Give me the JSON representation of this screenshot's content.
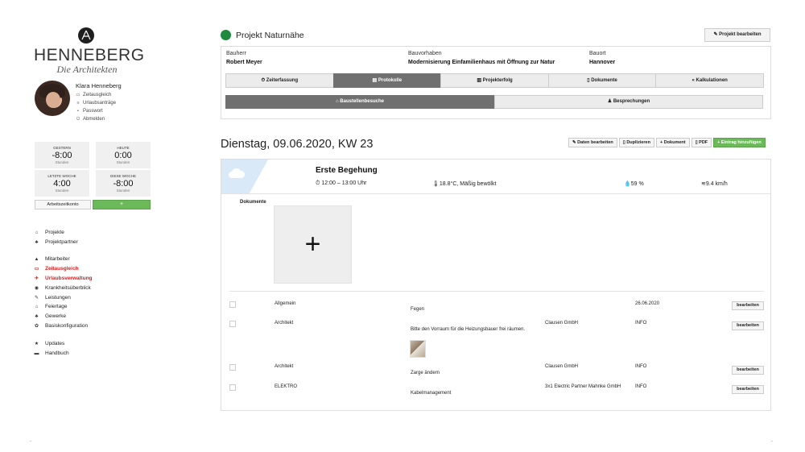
{
  "brand": {
    "name": "HENNEBERG",
    "tagline": "Die Architekten"
  },
  "user": {
    "name": "Klara Henneberg",
    "menu": [
      {
        "icon": "clock-icon",
        "glyph": "▭",
        "label": "Zeitausgleich"
      },
      {
        "icon": "list-icon",
        "glyph": "≡",
        "label": "Urlaubsanträge"
      },
      {
        "icon": "lock-icon",
        "glyph": "▪",
        "label": "Passwort"
      },
      {
        "icon": "power-icon",
        "glyph": "⏻",
        "label": "Abmelden"
      }
    ]
  },
  "stats": [
    {
      "label": "GESTERN",
      "value": "-8:00",
      "unit": "Stunden"
    },
    {
      "label": "HEUTE",
      "value": "0:00",
      "unit": "Stunden"
    },
    {
      "label": "LETZTE WOCHE",
      "value": "4:00",
      "unit": "Stunden"
    },
    {
      "label": "DIESE WOCHE",
      "value": "-8:00",
      "unit": "Stunden"
    }
  ],
  "stats_buttons": {
    "konto": "Arbeitszeitkonto",
    "add": "+"
  },
  "nav_groups": [
    [
      {
        "label": "Projekte",
        "glyph": "⌂",
        "active": false
      },
      {
        "label": "Projektpartner",
        "glyph": "♣",
        "active": false
      }
    ],
    [
      {
        "label": "Mitarbeiter",
        "glyph": "▲",
        "active": false
      },
      {
        "label": "Zeitausgleich",
        "glyph": "▭",
        "active": true
      },
      {
        "label": "Urlaubsverwaltung",
        "glyph": "✈",
        "active": true
      },
      {
        "label": "Krankheitsüberblick",
        "glyph": "◉",
        "active": false
      },
      {
        "label": "Leistungen",
        "glyph": "✎",
        "active": false
      },
      {
        "label": "Feiertage",
        "glyph": "⌂",
        "active": false
      },
      {
        "label": "Gewerke",
        "glyph": "♣",
        "active": false
      },
      {
        "label": "Basiskonfiguration",
        "glyph": "✿",
        "active": false
      }
    ],
    [
      {
        "label": "Updates",
        "glyph": "★",
        "active": false
      },
      {
        "label": "Handbuch",
        "glyph": "▬",
        "active": false
      }
    ]
  ],
  "project": {
    "title": "Projekt Naturnähe",
    "status_color": "#1d8a3e",
    "edit_label": "✎ Projekt bearbeiten",
    "bauherr_label": "Bauherr",
    "bauherr": "Robert Meyer",
    "bauvorhaben_label": "Bauvorhaben",
    "bauvorhaben": "Modernisierung Einfamilienhaus mit Öffnung zur Natur",
    "bauort_label": "Bauort",
    "bauort": "Hannover"
  },
  "tabs": [
    {
      "label": "⏱ Zeiterfassung",
      "active": false
    },
    {
      "label": "▤ Protokolle",
      "active": true
    },
    {
      "label": "▥ Projekterfolg",
      "active": false
    },
    {
      "label": "▯ Dokumente",
      "active": false
    },
    {
      "label": "« Kalkulationen",
      "active": false
    }
  ],
  "subtabs": [
    {
      "label": "⌂ Baustellenbesuche",
      "active": true
    },
    {
      "label": "♟ Besprechungen",
      "active": false
    }
  ],
  "day": {
    "title": "Dienstag, 09.06.2020, KW 23",
    "actions": [
      {
        "label": "✎ Daten bearbeiten",
        "green": false
      },
      {
        "label": "▯ Duplizieren",
        "green": false
      },
      {
        "label": "+ Dokument",
        "green": false
      },
      {
        "label": "▯ PDF",
        "green": false
      },
      {
        "label": "+ Eintrag hinzufügen",
        "green": true
      }
    ]
  },
  "entry": {
    "title": "Erste Begehung",
    "time": "⏱ 12:00 – 13:00 Uhr",
    "temperature": "18.8°C, Mäßig bewölkt",
    "humidity": "59 %",
    "wind": "9.4 km/h",
    "docs_label": "Dokumente",
    "add_doc": "+"
  },
  "rows": [
    {
      "category": "Allgemein",
      "description": "Fegen",
      "company": "",
      "status": "26.06.2020",
      "button": "bearbeiten"
    },
    {
      "category": "Architekt",
      "description": "Bitte den Vorraum für die Heizungsbauer frei räumen.",
      "company": "Clausen GmbH",
      "status": "INFO",
      "button": "bearbeiten"
    },
    {
      "category": "Architekt",
      "description": "Zarge ändern",
      "company": "Clausen GmbH",
      "status": "INFO",
      "button": "bearbeiten"
    },
    {
      "category": "ELEKTRO",
      "description": "Kabelmanagement",
      "company": "3x1 Electric Partner Mahnke GmbH",
      "status": "INFO",
      "button": "bearbeiten"
    }
  ]
}
